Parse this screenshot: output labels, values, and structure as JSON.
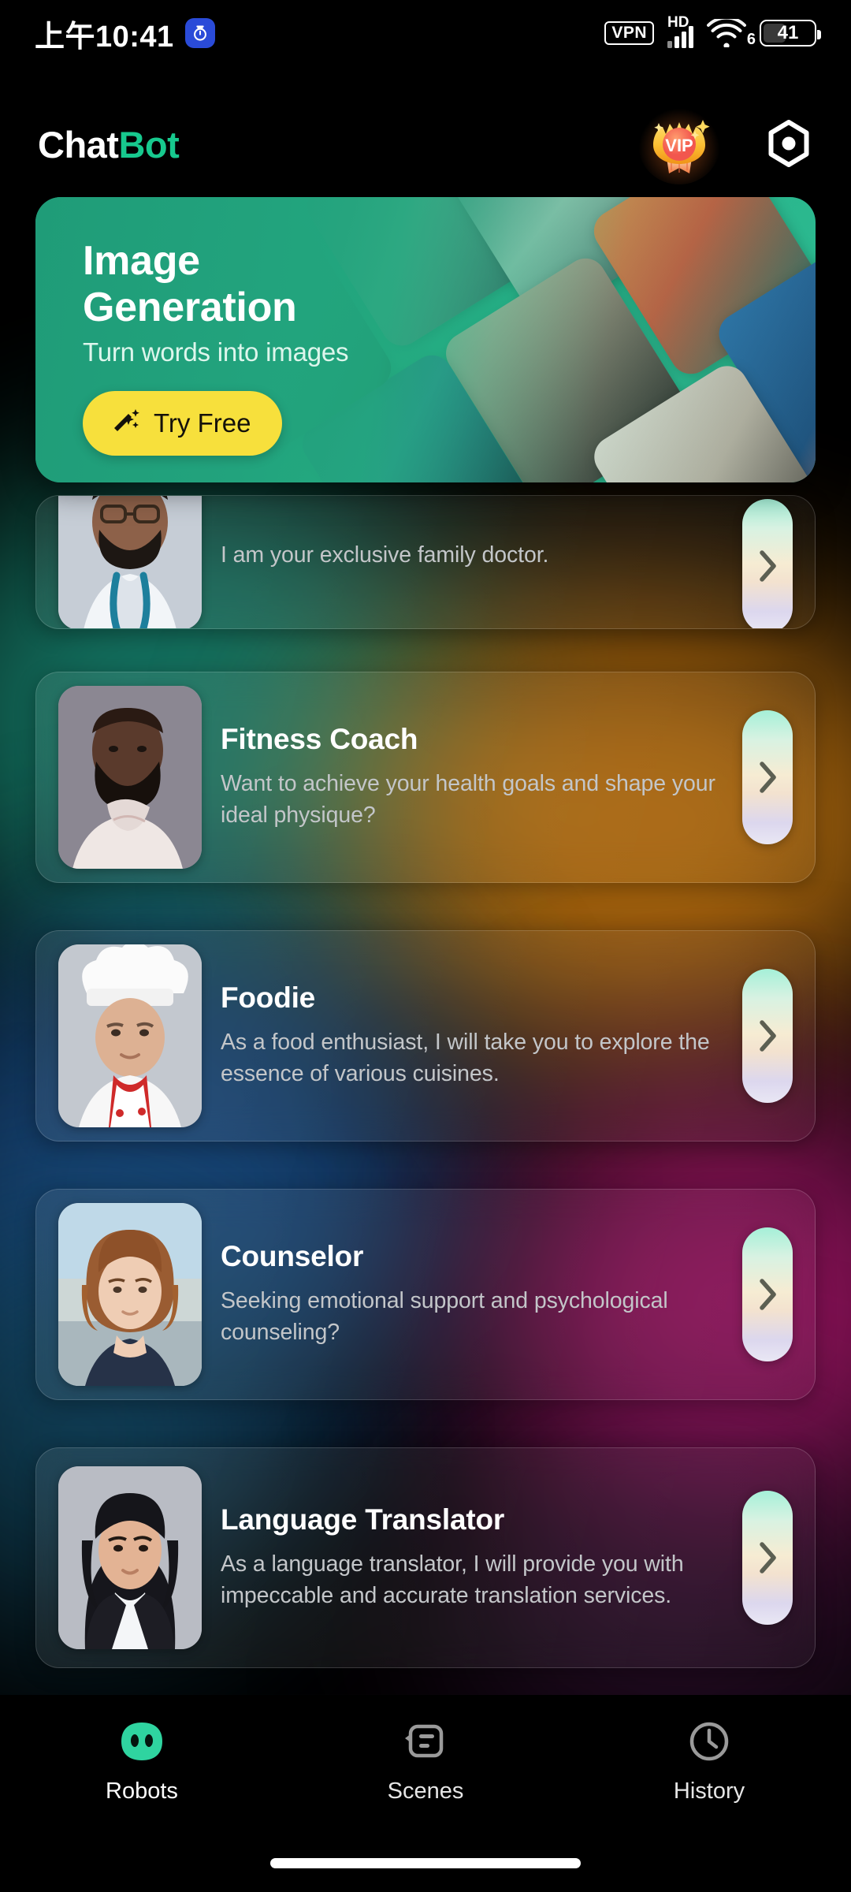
{
  "status_bar": {
    "time": "上午10:41",
    "app_icon": "stopwatch-icon",
    "vpn_label": "VPN",
    "hd_label": "HD",
    "signal_icon": "signal-bars-icon",
    "wifi_icon": "wifi-icon",
    "wifi_generation": "6",
    "battery_percent": "41"
  },
  "header": {
    "brand_part1": "Chat",
    "brand_part2": "Bot",
    "vip_label": "VIP",
    "vip_icon": "vip-medal-icon",
    "settings_icon": "hexagon-settings-icon"
  },
  "banner": {
    "title_line1": "Image",
    "title_line2": "Generation",
    "subtitle": "Turn words into images",
    "cta_label": "Try Free",
    "cta_icon": "magic-wand-icon",
    "accent_color": "#29b58c",
    "cta_color": "#f7e03c"
  },
  "robots": [
    {
      "name": "",
      "description": "I am your exclusive family doctor.",
      "avatar_icon": "doctor-avatar",
      "arrow_icon": "chevron-right-icon"
    },
    {
      "name": "Fitness Coach",
      "description": "Want to achieve your health goals and shape your ideal physique?",
      "avatar_icon": "fitness-coach-avatar",
      "arrow_icon": "chevron-right-icon"
    },
    {
      "name": "Foodie",
      "description": "As a food enthusiast, I will take you to explore the essence of various cuisines.",
      "avatar_icon": "chef-avatar",
      "arrow_icon": "chevron-right-icon"
    },
    {
      "name": "Counselor",
      "description": "Seeking emotional support and psychological counseling?",
      "avatar_icon": "counselor-avatar",
      "arrow_icon": "chevron-right-icon"
    },
    {
      "name": "Language Translator",
      "description": "As a language translator, I will provide you with impeccable and accurate translation services.",
      "avatar_icon": "translator-avatar",
      "arrow_icon": "chevron-right-icon"
    }
  ],
  "bottom_nav": {
    "items": [
      {
        "label": "Robots",
        "icon": "robot-face-icon",
        "active": true
      },
      {
        "label": "Scenes",
        "icon": "scene-card-icon",
        "active": false
      },
      {
        "label": "History",
        "icon": "clock-icon",
        "active": false
      }
    ],
    "active_color": "#2fd4a0",
    "inactive_color": "#9a9a9a"
  }
}
